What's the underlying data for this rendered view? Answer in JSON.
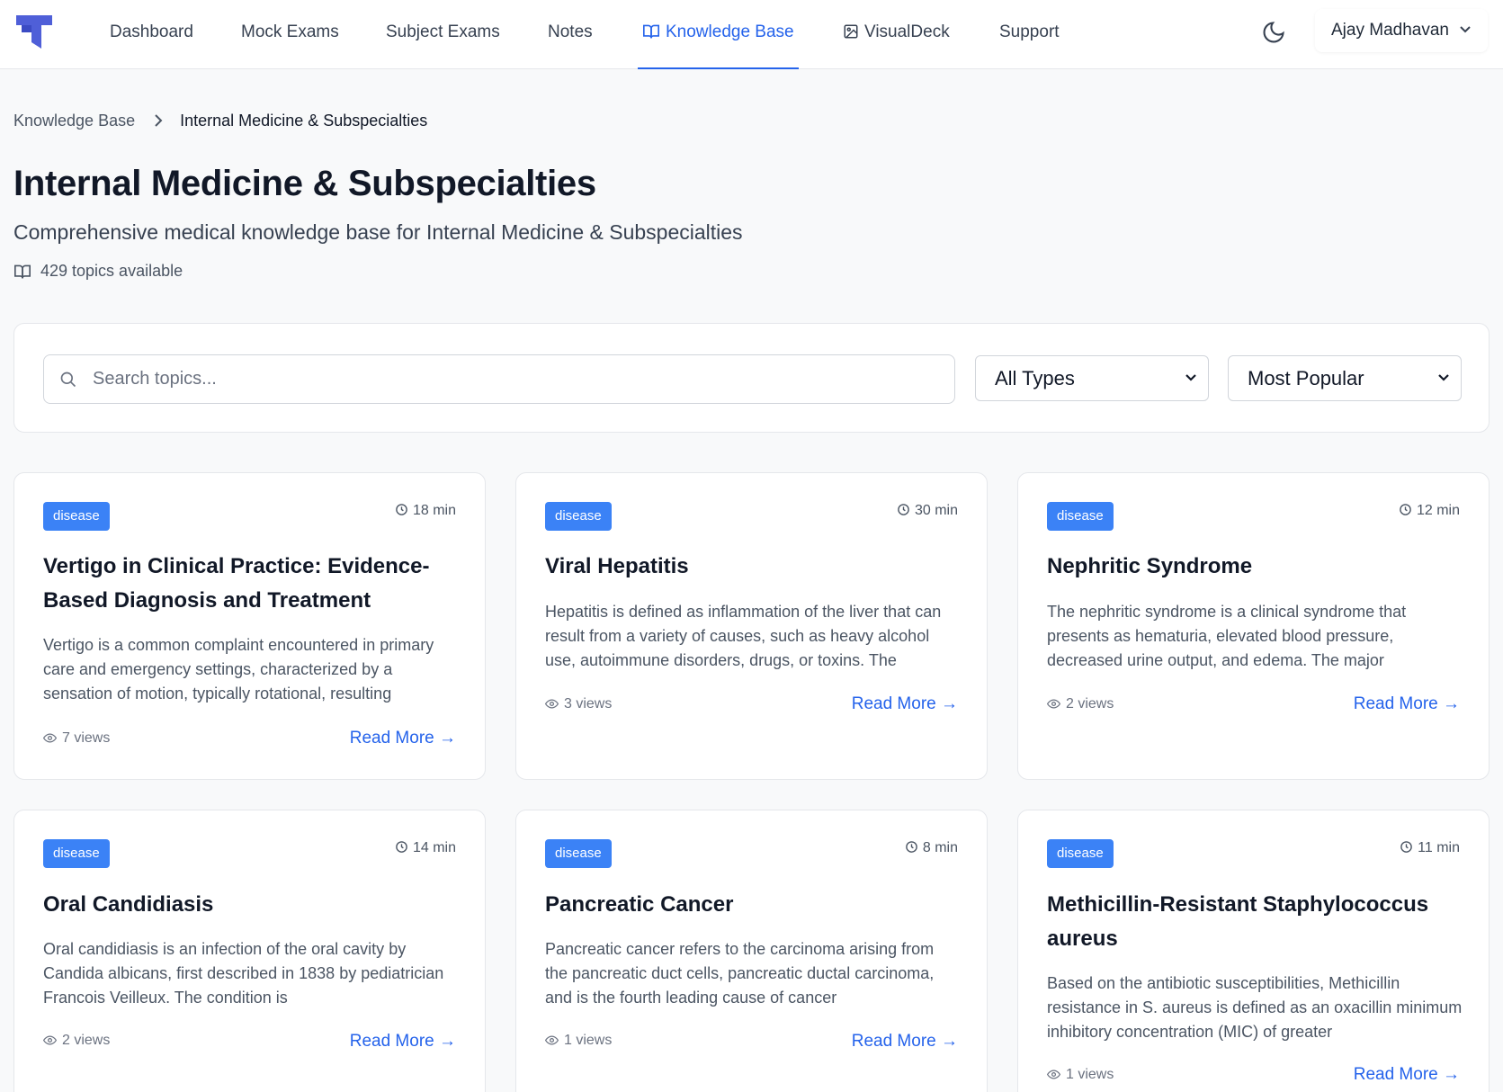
{
  "nav": {
    "items": [
      {
        "label": "Dashboard"
      },
      {
        "label": "Mock Exams"
      },
      {
        "label": "Subject Exams"
      },
      {
        "label": "Notes"
      },
      {
        "label": "Knowledge Base",
        "icon": "book-open-icon",
        "active": true
      },
      {
        "label": "VisualDeck",
        "icon": "image-icon"
      },
      {
        "label": "Support"
      }
    ],
    "theme_toggle_icon": "moon-icon",
    "user_name": "Ajay Madhavan"
  },
  "breadcrumb": {
    "root": "Knowledge Base",
    "current": "Internal Medicine & Subspecialties"
  },
  "page": {
    "title": "Internal Medicine & Subspecialties",
    "subtitle": "Comprehensive medical knowledge base for Internal Medicine & Subspecialties",
    "topic_count": "429 topics available"
  },
  "filters": {
    "search_placeholder": "Search topics...",
    "search_value": "",
    "type_selected": "All Types",
    "sort_selected": "Most Popular"
  },
  "cards": [
    {
      "badge": "disease",
      "read_time": "18 min",
      "title": "Vertigo in Clinical Practice: Evidence-Based Diagnosis and Treatment",
      "description": "Vertigo is a common complaint encountered in primary care and emergency settings, characterized by a sensation of motion, typically rotational, resulting",
      "views": "7 views",
      "link": "Read More →"
    },
    {
      "badge": "disease",
      "read_time": "30 min",
      "title": "Viral Hepatitis",
      "description": "Hepatitis is defined as inflammation of the liver that can result from a variety of causes, such as heavy alcohol use, autoimmune disorders, drugs, or toxins. The",
      "views": "3 views",
      "link": "Read More →"
    },
    {
      "badge": "disease",
      "read_time": "12 min",
      "title": "Nephritic Syndrome",
      "description": "The nephritic syndrome is a clinical syndrome that presents as hematuria, elevated blood pressure, decreased urine output, and edema. The major",
      "views": "2 views",
      "link": "Read More →"
    },
    {
      "badge": "disease",
      "read_time": "14 min",
      "title": "Oral Candidiasis",
      "description": "Oral candidiasis is an infection of the oral cavity by Candida albicans, first described in 1838 by pediatrician Francois Veilleux. The condition is",
      "views": "2 views",
      "link": "Read More →"
    },
    {
      "badge": "disease",
      "read_time": "8 min",
      "title": "Pancreatic Cancer",
      "description": "Pancreatic cancer refers to the carcinoma arising from the pancreatic duct cells, pancreatic ductal carcinoma, and is the fourth leading cause of cancer",
      "views": "1 views",
      "link": "Read More →"
    },
    {
      "badge": "disease",
      "read_time": "11 min",
      "title": "Methicillin-Resistant Staphylococcus aureus",
      "description": "Based on the antibiotic susceptibilities, Methicillin resistance in S. aureus is defined as an oxacillin minimum inhibitory concentration (MIC) of greater",
      "views": "1 views",
      "link": "Read More →"
    }
  ],
  "colors": {
    "accent": "#2563eb",
    "badge": "#3b82f6",
    "background": "#f8f9fa"
  }
}
